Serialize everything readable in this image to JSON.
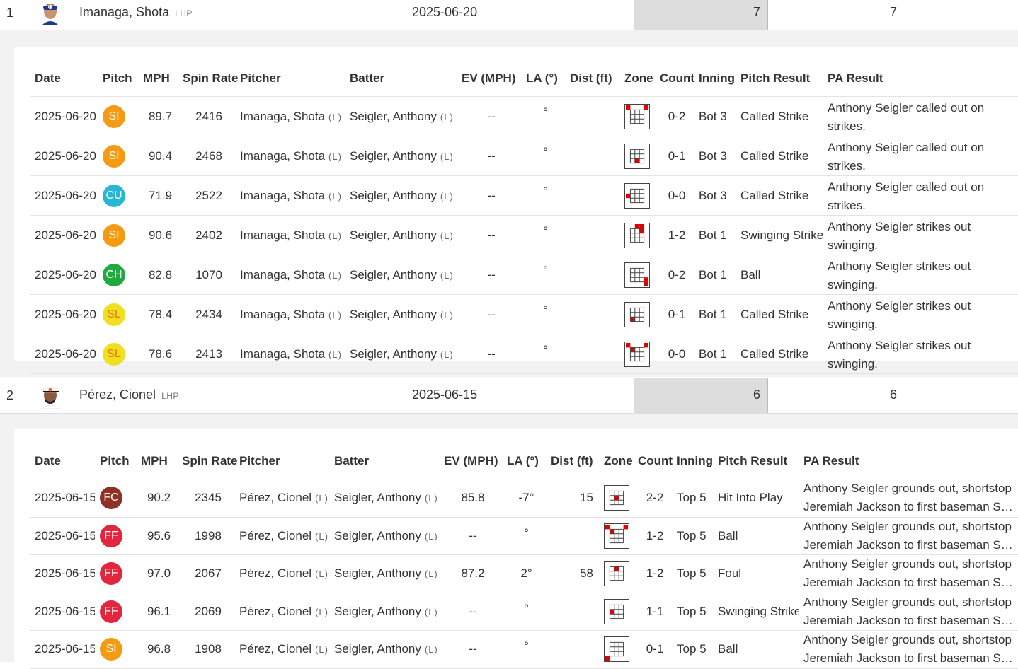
{
  "colors": {
    "SI": "#f59b11",
    "CU": "#27b7d6",
    "CH": "#1eaa3d",
    "SL": "#f0e020",
    "FC": "#8e3126",
    "FF": "#e3263e",
    "zone_hit": "#e00000"
  },
  "columns_1": [
    "Date",
    "Pitch",
    "MPH",
    "Spin Rate",
    "Pitcher",
    "Batter",
    "EV (MPH)",
    "LA (°)",
    "Dist (ft)",
    "Zone",
    "Count",
    "Inning",
    "Pitch Result",
    "PA Result"
  ],
  "columns_2": [
    "Date",
    "Pitch",
    "MPH",
    "Spin Rate",
    "Pitcher",
    "Batter",
    "EV (MPH)",
    "LA (°)",
    "Dist (ft)",
    "Zone",
    "Count",
    "Inning",
    "Pitch Result",
    "PA Result"
  ],
  "players": [
    {
      "rank": "1",
      "name": "Imanaga, Shota",
      "hand": "LHP",
      "date": "2025-06-20",
      "count": "7",
      "total": "7",
      "avatar": "cubs-player-avatar",
      "rows": [
        {
          "date": "2025-06-20",
          "pitch": "SI",
          "mph": "89.7",
          "spin": "2416",
          "pitcher": "Imanaga, Shota",
          "p_hand": "(L)",
          "batter": "Seigler, Anthony",
          "b_hand": "(L)",
          "ev": "--",
          "la": "°",
          "dist": "",
          "zone": [
            1,
            5
          ],
          "count": "0-2",
          "inning": "Bot 3",
          "result": "Called Strike",
          "pa": "Anthony Seigler called out on strikes."
        },
        {
          "date": "2025-06-20",
          "pitch": "SI",
          "mph": "90.4",
          "spin": "2468",
          "pitcher": "Imanaga, Shota",
          "p_hand": "(L)",
          "batter": "Seigler, Anthony",
          "b_hand": "(L)",
          "ev": "--",
          "la": "°",
          "dist": "",
          "zone": [
            18
          ],
          "count": "0-1",
          "inning": "Bot 3",
          "result": "Called Strike",
          "pa": "Anthony Seigler called out on strikes."
        },
        {
          "date": "2025-06-20",
          "pitch": "CU",
          "mph": "71.9",
          "spin": "2522",
          "pitcher": "Imanaga, Shota",
          "p_hand": "(L)",
          "batter": "Seigler, Anthony",
          "b_hand": "(L)",
          "ev": "--",
          "la": "°",
          "dist": "",
          "zone": [
            11
          ],
          "count": "0-0",
          "inning": "Bot 3",
          "result": "Called Strike",
          "pa": "Anthony Seigler called out on strikes."
        },
        {
          "date": "2025-06-20",
          "pitch": "SI",
          "mph": "90.6",
          "spin": "2402",
          "pitcher": "Imanaga, Shota",
          "p_hand": "(L)",
          "batter": "Seigler, Anthony",
          "b_hand": "(L)",
          "ev": "--",
          "la": "°",
          "dist": "",
          "zone": [
            3,
            4,
            9
          ],
          "count": "1-2",
          "inning": "Bot 1",
          "result": "Swinging Strike",
          "pa": "Anthony Seigler strikes out swinging."
        },
        {
          "date": "2025-06-20",
          "pitch": "CH",
          "mph": "82.8",
          "spin": "1070",
          "pitcher": "Imanaga, Shota",
          "p_hand": "(L)",
          "batter": "Seigler, Anthony",
          "b_hand": "(L)",
          "ev": "--",
          "la": "°",
          "dist": "",
          "zone": [
            20,
            25
          ],
          "count": "0-2",
          "inning": "Bot 1",
          "result": "Ball",
          "pa": "Anthony Seigler strikes out swinging."
        },
        {
          "date": "2025-06-20",
          "pitch": "SL",
          "mph": "78.4",
          "spin": "2434",
          "pitcher": "Imanaga, Shota",
          "p_hand": "(L)",
          "batter": "Seigler, Anthony",
          "b_hand": "(L)",
          "ev": "--",
          "la": "°",
          "dist": "",
          "zone": [
            17
          ],
          "count": "0-1",
          "inning": "Bot 1",
          "result": "Called Strike",
          "pa": "Anthony Seigler strikes out swinging."
        },
        {
          "date": "2025-06-20",
          "pitch": "SL",
          "mph": "78.6",
          "spin": "2413",
          "pitcher": "Imanaga, Shota",
          "p_hand": "(L)",
          "batter": "Seigler, Anthony",
          "b_hand": "(L)",
          "ev": "--",
          "la": "°",
          "dist": "",
          "zone": [
            1,
            5,
            7
          ],
          "count": "0-0",
          "inning": "Bot 1",
          "result": "Called Strike",
          "pa": "Anthony Seigler strikes out swinging."
        }
      ]
    },
    {
      "rank": "2",
      "name": "Pérez, Cionel",
      "hand": "LHP",
      "date": "2025-06-15",
      "count": "6",
      "total": "6",
      "avatar": "orioles-player-avatar",
      "rows": [
        {
          "date": "2025-06-15",
          "pitch": "FC",
          "mph": "90.2",
          "spin": "2345",
          "pitcher": "Pérez, Cionel",
          "p_hand": "(L)",
          "batter": "Seigler, Anthony",
          "b_hand": "(L)",
          "ev": "85.8",
          "la": "-7°",
          "dist": "15",
          "zone": [
            13
          ],
          "count": "2-2",
          "inning": "Top 5",
          "result": "Hit Into Play",
          "pa": "Anthony Seigler grounds out, shortstop",
          "pa2": "Jeremiah Jackson to first baseman Samu…"
        },
        {
          "date": "2025-06-15",
          "pitch": "FF",
          "mph": "95.6",
          "spin": "1998",
          "pitcher": "Pérez, Cionel",
          "p_hand": "(L)",
          "batter": "Seigler, Anthony",
          "b_hand": "(L)",
          "ev": "--",
          "la": "°",
          "dist": "",
          "zone": [
            1,
            5,
            7
          ],
          "count": "1-2",
          "inning": "Top 5",
          "result": "Ball",
          "pa": "Anthony Seigler grounds out, shortstop",
          "pa2": "Jeremiah Jackson to first baseman Samu…"
        },
        {
          "date": "2025-06-15",
          "pitch": "FF",
          "mph": "97.0",
          "spin": "2067",
          "pitcher": "Pérez, Cionel",
          "p_hand": "(L)",
          "batter": "Seigler, Anthony",
          "b_hand": "(L)",
          "ev": "87.2",
          "la": "2°",
          "dist": "58",
          "zone": [
            8
          ],
          "count": "1-2",
          "inning": "Top 5",
          "result": "Foul",
          "pa": "Anthony Seigler grounds out, shortstop",
          "pa2": "Jeremiah Jackson to first baseman Samu…"
        },
        {
          "date": "2025-06-15",
          "pitch": "FF",
          "mph": "96.1",
          "spin": "2069",
          "pitcher": "Pérez, Cionel",
          "p_hand": "(L)",
          "batter": "Seigler, Anthony",
          "b_hand": "(L)",
          "ev": "--",
          "la": "°",
          "dist": "",
          "zone": [
            12
          ],
          "count": "1-1",
          "inning": "Top 5",
          "result": "Swinging Strike",
          "pa": "Anthony Seigler grounds out, shortstop",
          "pa2": "Jeremiah Jackson to first baseman Samu…"
        },
        {
          "date": "2025-06-15",
          "pitch": "SI",
          "mph": "96.8",
          "spin": "1908",
          "pitcher": "Pérez, Cionel",
          "p_hand": "(L)",
          "batter": "Seigler, Anthony",
          "b_hand": "(L)",
          "ev": "--",
          "la": "°",
          "dist": "",
          "zone": [
            21
          ],
          "count": "0-1",
          "inning": "Top 5",
          "result": "Ball",
          "pa": "Anthony Seigler grounds out, shortstop",
          "pa2": "Jeremiah Jackson to first baseman Samu…"
        }
      ]
    }
  ]
}
